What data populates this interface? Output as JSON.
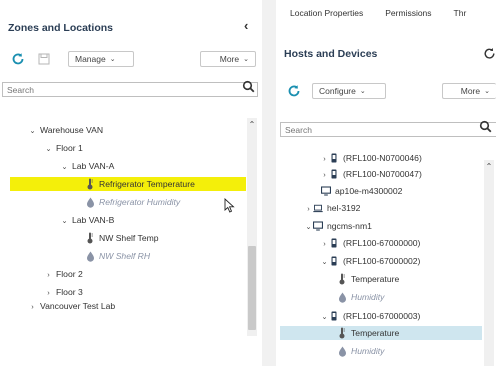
{
  "left_panel": {
    "title": "Zones and Locations",
    "toolbar": {
      "manage_label": "Manage",
      "more_label": "More"
    },
    "search": {
      "placeholder": "Search"
    },
    "tree": [
      {
        "label": "Warehouse VAN",
        "toggle": "⌄",
        "icon": "none",
        "depth": 0
      },
      {
        "label": "Floor 1",
        "toggle": "⌄",
        "icon": "none",
        "depth": 1
      },
      {
        "label": "Lab VAN-A",
        "toggle": "⌄",
        "icon": "none",
        "depth": 2
      },
      {
        "label": "Refrigerator Temperature",
        "toggle": "",
        "icon": "thermometer",
        "depth": 3,
        "state": "selected"
      },
      {
        "label": "Refrigerator Humidity",
        "toggle": "",
        "icon": "droplet",
        "depth": 3,
        "state": "inactive"
      },
      {
        "label": "Lab VAN-B",
        "toggle": "⌄",
        "icon": "none",
        "depth": 2
      },
      {
        "label": "NW Shelf Temp",
        "toggle": "",
        "icon": "thermometer",
        "depth": 3
      },
      {
        "label": "NW Shelf RH",
        "toggle": "",
        "icon": "droplet",
        "depth": 3,
        "state": "inactive"
      },
      {
        "label": "Floor 2",
        "toggle": "›",
        "icon": "none",
        "depth": 1
      },
      {
        "label": "Floor 3",
        "toggle": "›",
        "icon": "none",
        "depth": 1
      },
      {
        "label": "Vancouver Test Lab",
        "toggle": "›",
        "icon": "none",
        "depth": 0
      }
    ]
  },
  "right_panel": {
    "tabs": [
      "Location Properties",
      "Permissions",
      "Thr"
    ],
    "title": "Hosts and Devices",
    "toolbar": {
      "configure_label": "Configure",
      "more_label": "More"
    },
    "search": {
      "placeholder": "Search"
    },
    "tree": [
      {
        "label": "(RFL100-N0700046)",
        "toggle": "›",
        "icon": "device",
        "depth": 2
      },
      {
        "label": "(RFL100-N0700047)",
        "toggle": "›",
        "icon": "device",
        "depth": 2
      },
      {
        "label": "ap10e-m4300002",
        "toggle": "",
        "icon": "monitor",
        "depth": 1
      },
      {
        "label": "hel-3192",
        "toggle": "›",
        "icon": "laptop",
        "depth": 0
      },
      {
        "label": "ngcms-nm1",
        "toggle": "⌄",
        "icon": "monitor",
        "depth": 0
      },
      {
        "label": "(RFL100-67000000)",
        "toggle": "›",
        "icon": "device",
        "depth": 2
      },
      {
        "label": "(RFL100-67000002)",
        "toggle": "⌄",
        "icon": "device",
        "depth": 2
      },
      {
        "label": "Temperature",
        "toggle": "",
        "icon": "thermometer",
        "depth": 3
      },
      {
        "label": "Humidity",
        "toggle": "",
        "icon": "droplet",
        "depth": 3,
        "state": "inactive"
      },
      {
        "label": "(RFL100-67000003)",
        "toggle": "⌄",
        "icon": "device",
        "depth": 2
      },
      {
        "label": "Temperature",
        "toggle": "",
        "icon": "thermometer",
        "depth": 3,
        "state": "selected"
      },
      {
        "label": "Humidity",
        "toggle": "",
        "icon": "droplet",
        "depth": 3,
        "state": "inactive"
      }
    ]
  },
  "colors": {
    "accent_teal": "#1a8fb0",
    "selected_yellow": "#f4ef0a",
    "selected_blue": "#cfe6ef",
    "title_navy": "#2b3e55",
    "muted_text": "#8a93a6"
  }
}
